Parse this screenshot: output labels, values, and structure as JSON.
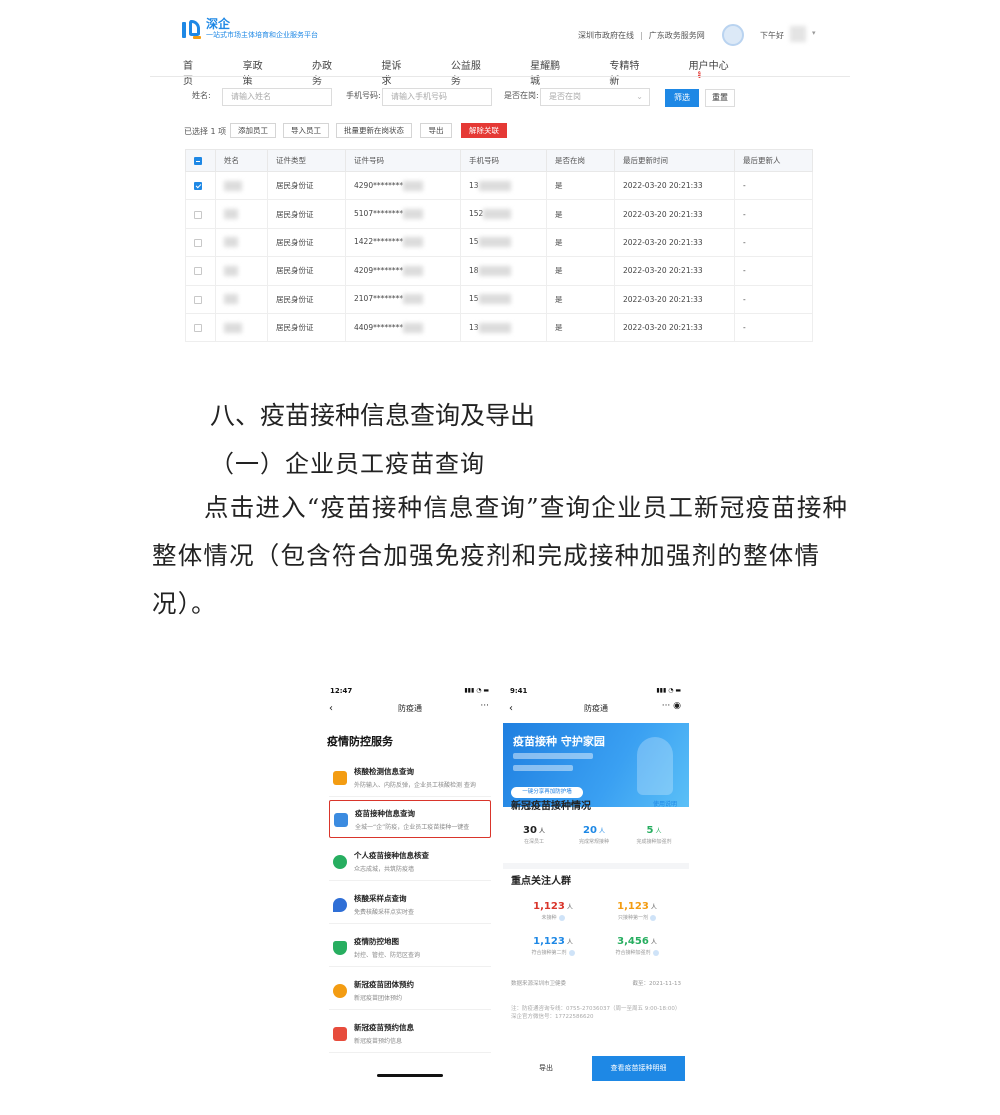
{
  "web": {
    "brand": {
      "name": "深企",
      "subtitle": "一站式市场主体培育和企业服务平台"
    },
    "top_links": [
      "深圳市政府在线",
      "广东政务服务网"
    ],
    "user_greeting": "下午好",
    "nav": [
      "首页",
      "享政策",
      "办政务",
      "提诉求",
      "公益服务",
      "星耀鹏城",
      "专精特新",
      "用户中心"
    ],
    "nav_badge": "4",
    "filters": {
      "name_label": "姓名:",
      "name_placeholder": "请输入姓名",
      "phone_label": "手机号码:",
      "phone_placeholder": "请输入手机号码",
      "active_label": "是否在岗:",
      "active_placeholder": "是否在岗",
      "filter_btn": "筛选",
      "reset_btn": "重置"
    },
    "selected_text": "已选择 1 项",
    "actions": [
      "添加员工",
      "导入员工",
      "批量更新在岗状态",
      "导出",
      "解除关联"
    ],
    "columns": [
      "姓名",
      "证件类型",
      "证件号码",
      "手机号码",
      "是否在岗",
      "最后更新时间",
      "最后更新人"
    ],
    "rows": [
      {
        "id_type": "居民身份证",
        "id_no": "4290********",
        "phone": "13",
        "active": "是",
        "updated": "2022-03-20 20:21:33",
        "updater": "-"
      },
      {
        "id_type": "居民身份证",
        "id_no": "5107********",
        "phone": "152",
        "active": "是",
        "updated": "2022-03-20 20:21:33",
        "updater": "-"
      },
      {
        "id_type": "居民身份证",
        "id_no": "1422********",
        "phone": "15",
        "active": "是",
        "updated": "2022-03-20 20:21:33",
        "updater": "-"
      },
      {
        "id_type": "居民身份证",
        "id_no": "4209********",
        "phone": "18",
        "active": "是",
        "updated": "2022-03-20 20:21:33",
        "updater": "-"
      },
      {
        "id_type": "居民身份证",
        "id_no": "2107********",
        "phone": "15",
        "active": "是",
        "updated": "2022-03-20 20:21:33",
        "updater": "-"
      },
      {
        "id_type": "居民身份证",
        "id_no": "4409********",
        "phone": "13",
        "active": "是",
        "updated": "2022-03-20 20:21:33",
        "updater": "-"
      }
    ]
  },
  "doc": {
    "heading": "八、疫苗接种信息查询及导出",
    "subheading": "（一）企业员工疫苗查询",
    "paragraph": "点击进入“疫苗接种信息查询”查询企业员工新冠疫苗接种整体情况（包含符合加强免疫剂和完成接种加强剂的整体情况）。"
  },
  "phone1": {
    "time": "12:47",
    "title": "防疫通",
    "section": "疫情防控服务",
    "services": [
      {
        "title": "核酸检测信息查询",
        "desc": "外防输入、内防反弹，企业员工核酸检测 查询",
        "color": "#f39c12"
      },
      {
        "title": "疫苗接种信息查询",
        "desc": "全城一“企”防疫，企业员工疫苗接种一键查",
        "color": "#3b8be0"
      },
      {
        "title": "个人疫苗接种信息核查",
        "desc": "众志成城，共筑防疫墙",
        "color": "#27ae60"
      },
      {
        "title": "核酸采样点查询",
        "desc": "免费核酸采样点实时查",
        "color": "#2f6fd6"
      },
      {
        "title": "疫情防控地图",
        "desc": "封控、管控、防范区查询",
        "color": "#27ae60"
      },
      {
        "title": "新冠疫苗团体预约",
        "desc": "新冠疫苗团体预约",
        "color": "#f39c12"
      },
      {
        "title": "新冠疫苗预约信息",
        "desc": "新冠疫苗预约信息",
        "color": "#e74c3c"
      }
    ]
  },
  "phone2": {
    "time": "9:41",
    "title": "防疫通",
    "banner_title": "疫苗接种 守护家园",
    "banner_btn": "一键分享再加防护墙",
    "vacc_title": "新冠疫苗接种情况",
    "vacc_link": "使用说明",
    "stats": [
      {
        "value": "30",
        "unit": "人",
        "label": "在深员工",
        "color": "#222222"
      },
      {
        "value": "20",
        "unit": "人",
        "label": "完成常规接种",
        "color": "#1e88e5"
      },
      {
        "value": "5",
        "unit": "人",
        "label": "完成接种加强剂",
        "color": "#27ae60"
      }
    ],
    "key_title": "重点关注人群",
    "key_stats": [
      {
        "value": "1,123",
        "unit": "人",
        "label": "未接种",
        "color": "#d9352b"
      },
      {
        "value": "1,123",
        "unit": "人",
        "label": "只接种第一剂",
        "color": "#f39c12"
      },
      {
        "value": "1,123",
        "unit": "人",
        "label": "符合接种第二剂",
        "color": "#1e88e5"
      },
      {
        "value": "3,456",
        "unit": "人",
        "label": "符合接种加强剂",
        "color": "#27ae60"
      }
    ],
    "source": "数据来源深圳市卫健委",
    "as_of": "截至：2021-11-13",
    "notes": "注：防疫通咨询专线：0755-27036037（周一至周五 9:00-18:00） 深企官方微信号：17722586620",
    "export_btn": "导出",
    "view_btn": "查看疫苗接种明细"
  }
}
